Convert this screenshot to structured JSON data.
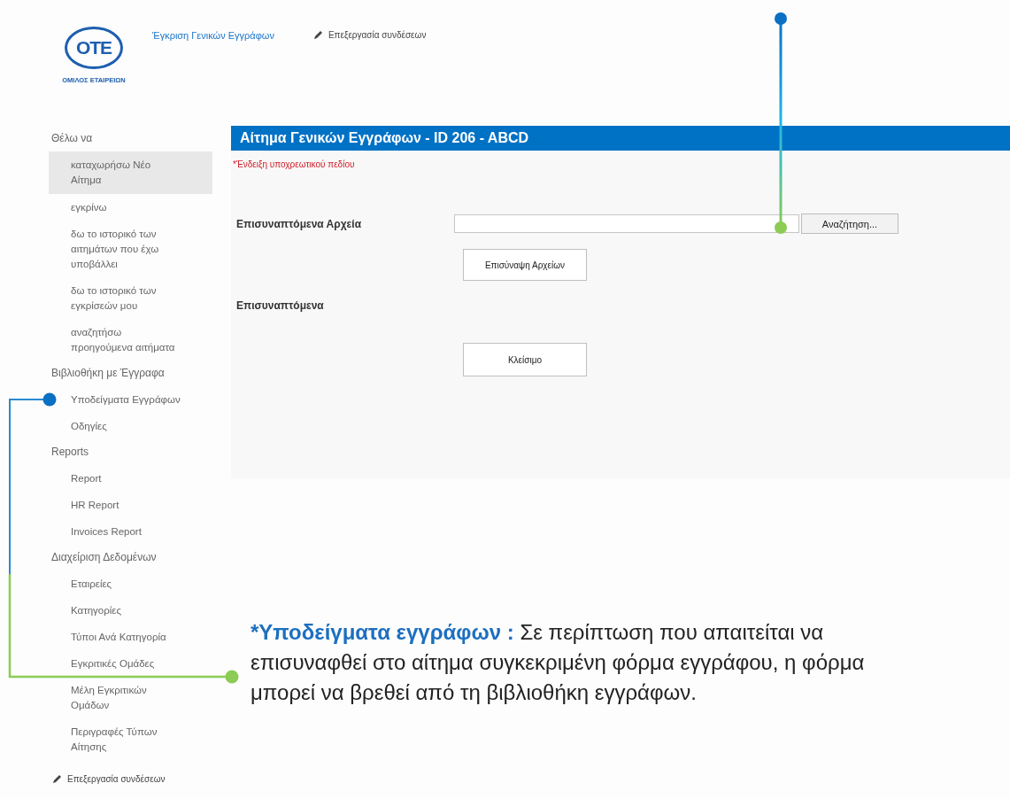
{
  "header": {
    "logo": {
      "mark": "OTE",
      "subtitle": "ΟΜΙΛΟΣ ΕΤΑΙΡΕΙΩΝ"
    },
    "site_title": "Έγκριση Γενικών Εγγράφων",
    "edit_links": "Επεξεργασία συνδέσεων"
  },
  "sidebar": {
    "sections": [
      {
        "label": "Θέλω να",
        "children": [
          {
            "label": "καταχωρήσω Νέο Αίτημα",
            "selected": true
          },
          {
            "label": "εγκρίνω",
            "selected": false
          },
          {
            "label": "δω το ιστορικό των αιτημάτων που έχω υποβάλλει",
            "selected": false
          },
          {
            "label": "δω το ιστορικό των εγκρίσεών μου",
            "selected": false
          },
          {
            "label": "αναζητήσω προηγούμενα αιτήματα",
            "selected": false
          }
        ]
      },
      {
        "label": "Βιβλιοθήκη με Έγγραφα",
        "children": [
          {
            "label": "Υποδείγματα Εγγράφων",
            "selected": false
          },
          {
            "label": "Οδηγίες",
            "selected": false
          }
        ]
      },
      {
        "label": "Reports",
        "children": [
          {
            "label": "Report",
            "selected": false
          },
          {
            "label": "HR Report",
            "selected": false
          },
          {
            "label": "Invoices Report",
            "selected": false
          }
        ]
      },
      {
        "label": "Διαχείριση Δεδομένων",
        "children": [
          {
            "label": "Εταιρείες",
            "selected": false
          },
          {
            "label": "Κατηγορίες",
            "selected": false
          },
          {
            "label": "Τύποι Ανά Κατηγορία",
            "selected": false
          },
          {
            "label": "Εγκριτικές Ομάδες",
            "selected": false
          },
          {
            "label": "Μέλη Εγκριτικών Ομάδων",
            "selected": false
          },
          {
            "label": "Περιγραφές Τύπων Αίτησης",
            "selected": false
          }
        ]
      }
    ],
    "edit_links": "Επεξεργασία συνδέσεων"
  },
  "form": {
    "title": "Αίτημα Γενικών Εγγράφων - ID 206 - ABCD",
    "required_note": "*Ένδειξη υποχρεωτικού πεδίου",
    "attachments_label": "Επισυναπτόμενα Αρχεία",
    "browse_button": "Αναζήτηση...",
    "attach_button": "Επισύναψη Αρχείων",
    "attached_label": "Επισυναπτόμενα",
    "close_button": "Κλείσιμο"
  },
  "annotation": {
    "text": "**Υποδείγματα εγγράφων :** Σε περίπτωση που απαιτείται να επισυναφθεί στο αίτημα συγκεκριμένη φόρμα εγγράφου, η φόρμα μπορεί να βρεθεί από τη βιβλιοθήκη εγγράφων.",
    "marker": "*"
  }
}
